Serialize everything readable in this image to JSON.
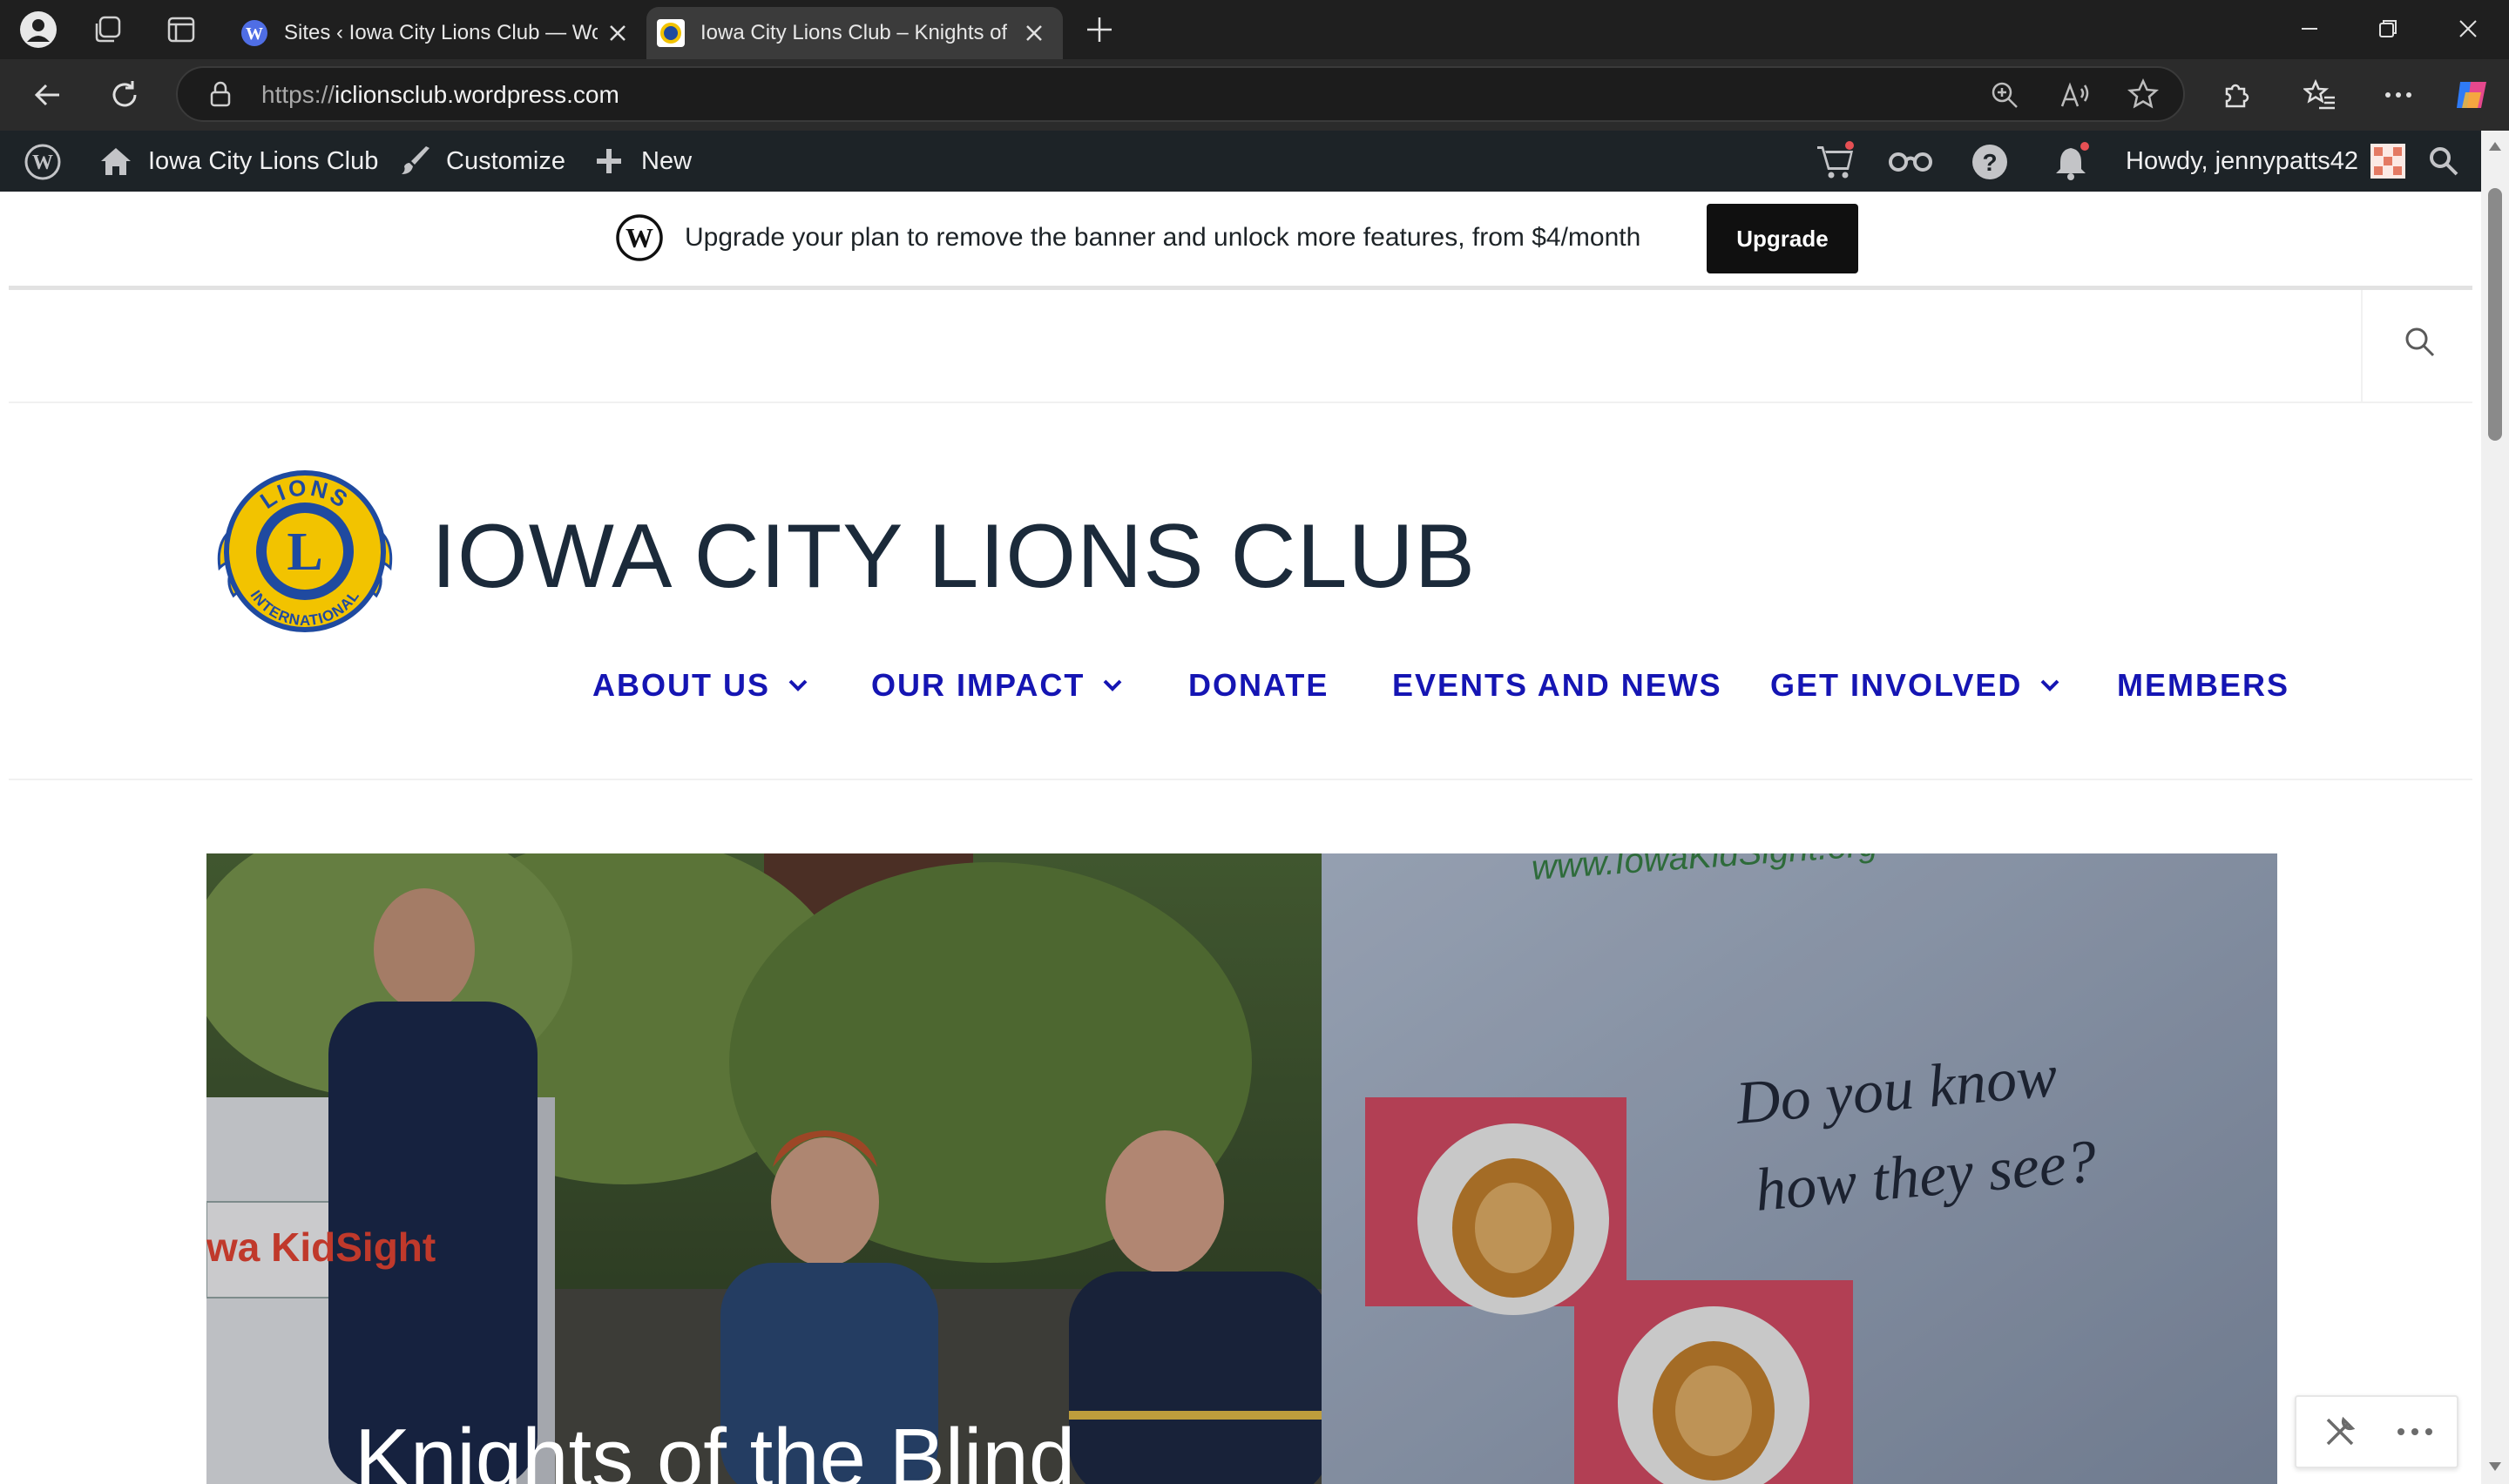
{
  "browser": {
    "tabs": [
      {
        "title": "Sites ‹ Iowa City Lions Club — Wo",
        "active": false
      },
      {
        "title": "Iowa City Lions Club – Knights of",
        "active": true
      }
    ],
    "url_scheme": "https://",
    "url_host": "iclionsclub.wordpress.com"
  },
  "admin_bar": {
    "site_name": "Iowa City Lions Club",
    "customize": "Customize",
    "new": "New",
    "howdy": "Howdy, jennypatts42"
  },
  "banner": {
    "text": "Upgrade your plan to remove the banner and unlock more features, from $4/month",
    "button": "Upgrade"
  },
  "site": {
    "title": "IOWA CITY LIONS CLUB",
    "logo_text_top": "LIONS",
    "logo_letter": "L",
    "logo_text_bottom": "INTERNATIONAL"
  },
  "nav": [
    {
      "label": "ABOUT US",
      "has_dropdown": true
    },
    {
      "label": "OUR IMPACT",
      "has_dropdown": true
    },
    {
      "label": "DONATE",
      "has_dropdown": false
    },
    {
      "label": "EVENTS AND NEWS",
      "has_dropdown": false
    },
    {
      "label": "GET INVOLVED",
      "has_dropdown": true
    },
    {
      "label": "MEMBERS",
      "has_dropdown": false
    }
  ],
  "hero": {
    "title": "Knights of the Blind",
    "photo_sign_left": "wa KidSight",
    "photo_url_text": "www.IowaKidSight.org",
    "photo_sign_right_line1": "Do you know",
    "photo_sign_right_line2": "how they see?"
  },
  "colors": {
    "nav": "#1515b3",
    "title": "#1b2a3a",
    "admin_bar": "#1d2327",
    "lions_blue": "#1f4aa0",
    "lions_gold": "#f2c300"
  }
}
